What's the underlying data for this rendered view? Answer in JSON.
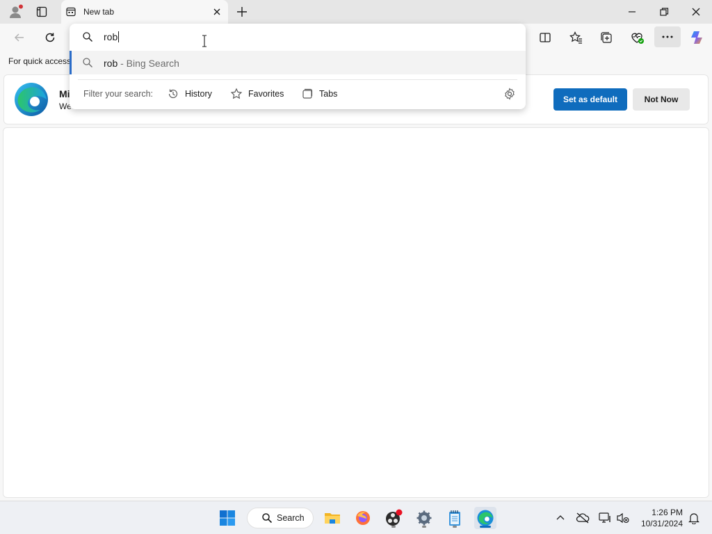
{
  "tab": {
    "title": "New tab"
  },
  "omnibox": {
    "value": "rob",
    "suggestion_query": "rob",
    "suggestion_source": " - Bing Search",
    "filter_label": "Filter your search:",
    "filters": [
      "History",
      "Favorites",
      "Tabs"
    ]
  },
  "favorites_bar": {
    "text": "For quick access"
  },
  "banner": {
    "title": "Mi",
    "subtitle": "We",
    "primary_button": "Set as default",
    "secondary_button": "Not Now"
  },
  "taskbar": {
    "search_label": "Search",
    "clock_time": "1:26 PM",
    "clock_date": "10/31/2024"
  },
  "colors": {
    "accent": "#0f6cbd",
    "suggestion_bar": "#2a6cc8"
  }
}
